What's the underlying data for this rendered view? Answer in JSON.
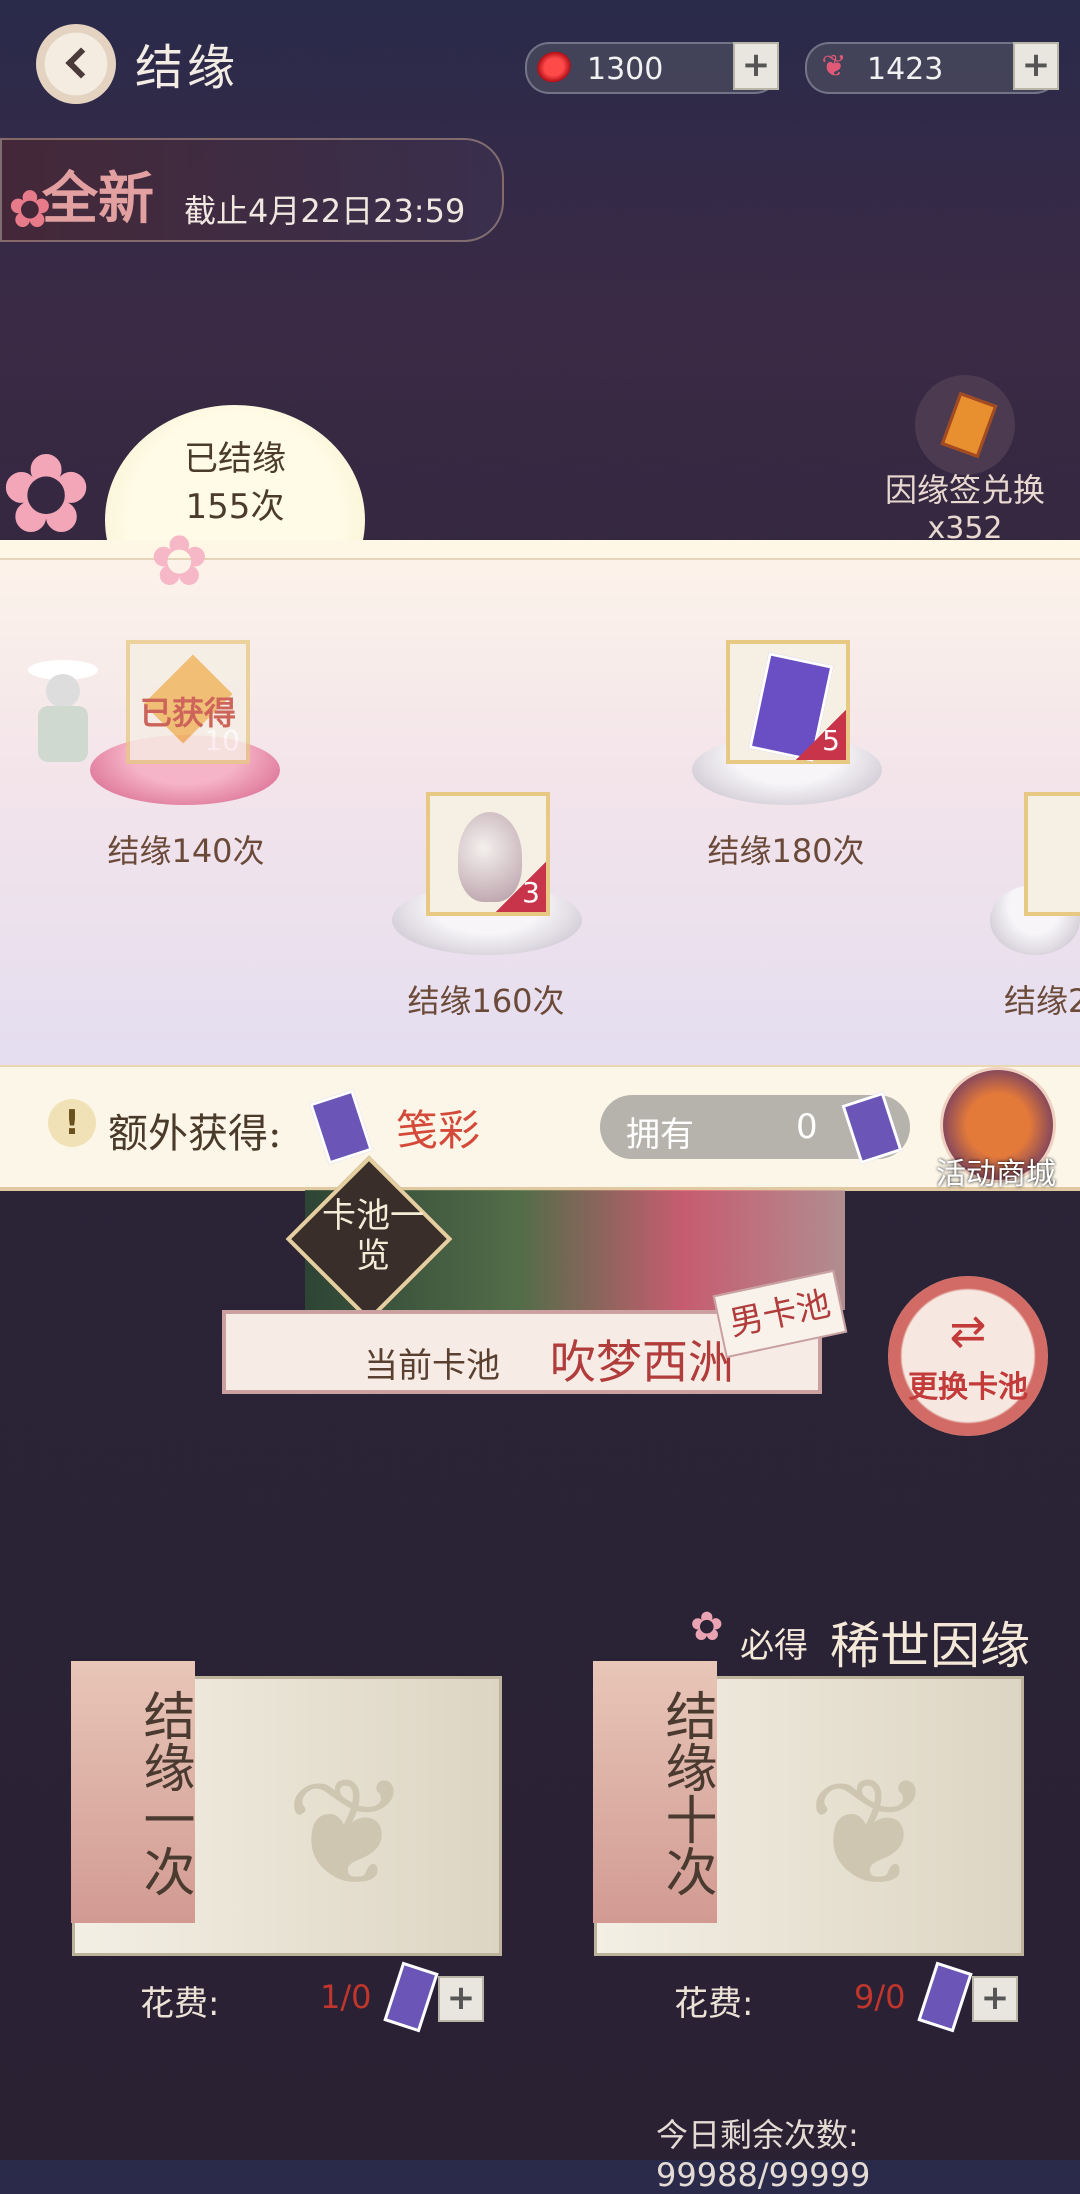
{
  "header": {
    "title": "结缘"
  },
  "currencies": [
    {
      "icon": "red-gem-icon",
      "value": "1300",
      "plus": "+"
    },
    {
      "icon": "butterfly-icon",
      "value": "1423",
      "plus": "+"
    }
  ],
  "banner": {
    "badge": "全新",
    "deadline": "截止4月22日23:59"
  },
  "progress": {
    "label": "已结缘",
    "count": "155次"
  },
  "exchange": {
    "label": "因缘签兑换",
    "count": "x352"
  },
  "milestones": [
    {
      "label": "结缘140次",
      "status": "已获得",
      "qty": "10"
    },
    {
      "label": "结缘160次",
      "qty": "3"
    },
    {
      "label": "结缘180次",
      "qty": "5"
    },
    {
      "label": "结缘2"
    }
  ],
  "extra": {
    "icon": "!",
    "label": "额外获得:",
    "item": "笺彩",
    "own_label": "拥有",
    "own_value": "0",
    "shop_label": "活动商城"
  },
  "pool": {
    "list_label": "卡池一览",
    "current_label": "当前卡池",
    "name": "吹梦西洲",
    "tag": "男卡池",
    "switch_icon": "⇄",
    "switch_label": "更换卡池",
    "guarantee_prefix": "必得",
    "guarantee_text": "稀世因缘"
  },
  "draws": [
    {
      "title": "结缘一次",
      "cost_label": "花费:",
      "cost_value": "1/0",
      "plus": "+"
    },
    {
      "title": "结缘十次",
      "cost_label": "花费:",
      "cost_value": "9/0",
      "plus": "+"
    }
  ],
  "remaining": "今日剩余次数: 99988/99999",
  "colors": {
    "accent_red": "#c0362c",
    "gold_border": "#e7c983",
    "ticket_purple": "#6b56b8"
  }
}
